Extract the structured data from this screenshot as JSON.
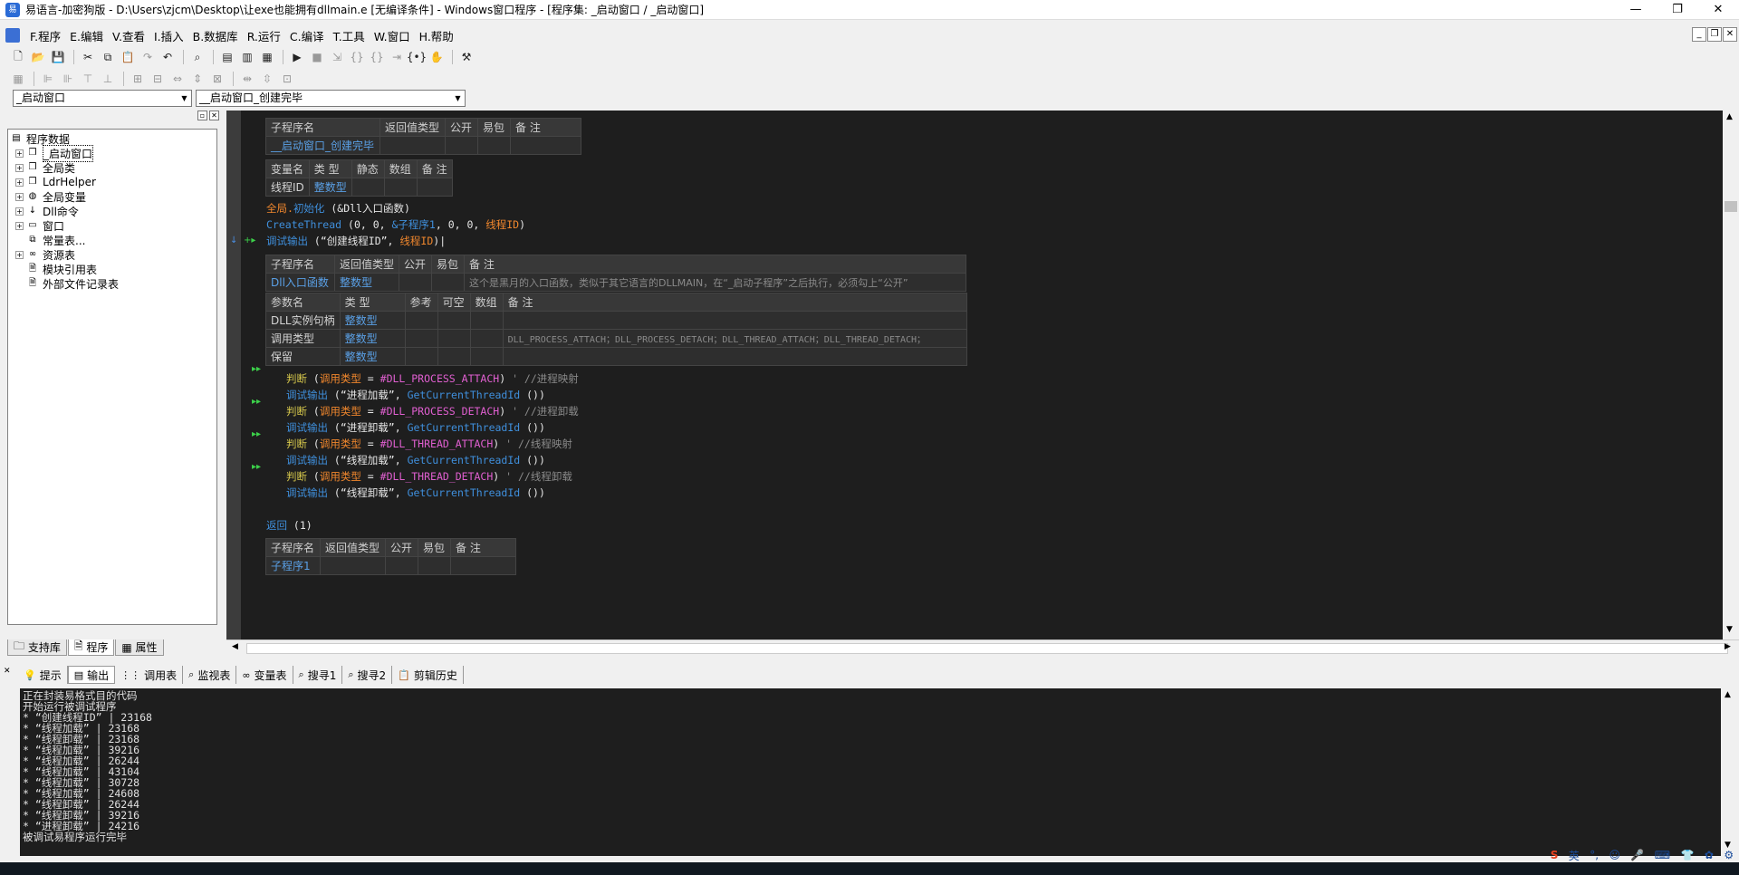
{
  "window": {
    "title": "易语言-加密狗版 - D:\\Users\\zjcm\\Desktop\\让exe也能拥有dllmain.e [无编译条件] - Windows窗口程序 - [程序集: _启动窗口 / _启动窗口]"
  },
  "menu": [
    "F.程序",
    "E.编辑",
    "V.查看",
    "I.插入",
    "B.数据库",
    "R.运行",
    "C.编译",
    "T.工具",
    "W.窗口",
    "H.帮助"
  ],
  "combos": {
    "left": "_启动窗口",
    "right": "__启动窗口_创建完毕"
  },
  "tree": {
    "root": "程序数据",
    "items": [
      "_启动窗口",
      "全局类",
      "LdrHelper",
      "全局变量",
      "Dll命令",
      "窗口",
      "常量表...",
      "资源表",
      "模块引用表",
      "外部文件记录表"
    ]
  },
  "panel_tabs": [
    "支持库",
    "程序",
    "属性"
  ],
  "code": {
    "t1": {
      "h": [
        "子程序名",
        "返回值类型",
        "公开",
        "易包",
        "备 注"
      ],
      "r": [
        "__启动窗口_创建完毕",
        "",
        "",
        "",
        ""
      ]
    },
    "t2": {
      "h": [
        "变量名",
        "类 型",
        "静态",
        "数组",
        "备 注"
      ],
      "r": [
        "线程ID",
        "整数型",
        "",
        "",
        ""
      ]
    },
    "line1": {
      "a": "全局.",
      "b": "初始化",
      "c": " (&Dll入口函数)"
    },
    "line2": {
      "a": "CreateThread",
      "b": " (0, 0, ",
      "c": "&子程序1",
      "d": ", 0, 0, ",
      "e": "线程ID",
      ")": ")"
    },
    "line3": {
      "a": "调试输出",
      "b": " (“创建线程ID”, ",
      "c": "线程ID",
      ")": ")"
    },
    "t3": {
      "h": [
        "子程序名",
        "返回值类型",
        "公开",
        "易包",
        "备 注"
      ],
      "r": [
        "Dll入口函数",
        "整数型",
        "",
        "",
        "这个是黑月的入口函数，类似于其它语言的DLLMAIN，在“_启动子程序”之后执行，必须勾上“公开”"
      ]
    },
    "t4": {
      "h": [
        "参数名",
        "类 型",
        "参考",
        "可空",
        "数组",
        "备 注"
      ],
      "rows": [
        [
          "DLL实例句柄",
          "整数型",
          "",
          "",
          "",
          ""
        ],
        [
          "调用类型",
          "整数型",
          "",
          "",
          "",
          "DLL_PROCESS_ATTACH；DLL_PROCESS_DETACH；DLL_THREAD_ATTACH；DLL_THREAD_DETACH；"
        ],
        [
          "保留",
          "整数型",
          "",
          "",
          "",
          ""
        ]
      ]
    },
    "ifs": [
      {
        "cond": "#DLL_PROCESS_ATTACH",
        "cmt": "' //进程映射",
        "body": "“进程加载”"
      },
      {
        "cond": "#DLL_PROCESS_DETACH",
        "cmt": "' //进程卸载",
        "body": "“进程卸载”"
      },
      {
        "cond": "#DLL_THREAD_ATTACH",
        "cmt": "' //线程映射",
        "body": "“线程加载”"
      },
      {
        "cond": "#DLL_THREAD_DETACH",
        "cmt": "' //线程卸载",
        "body": "“线程卸载”"
      }
    ],
    "kw_if": "判断",
    "kw_var": "调用类型",
    "eq": " = ",
    "kw_dbg": "调试输出",
    "fn": "GetCurrentThreadId",
    "fn_args": " ())",
    "ret": {
      "a": "返回",
      "b": " (1)"
    },
    "t5": {
      "h": [
        "子程序名",
        "返回值类型",
        "公开",
        "易包",
        "备 注"
      ],
      "r": [
        "子程序1",
        "",
        "",
        "",
        ""
      ]
    }
  },
  "output_tabs": [
    "提示",
    "输出",
    "调用表",
    "监视表",
    "变量表",
    "搜寻1",
    "搜寻2",
    "剪辑历史"
  ],
  "output_lines": [
    "正在封装易格式目的代码",
    "开始运行被调试程序",
    "* “创建线程ID” | 23168",
    "* “线程加载” | 23168",
    "* “线程卸载” | 23168",
    "* “线程加载” | 39216",
    "* “线程加载” | 26244",
    "* “线程加载” | 43104",
    "* “线程加载” | 30728",
    "* “线程加载” | 24608",
    "* “线程卸载” | 26244",
    "* “线程卸载” | 39216",
    "* “进程卸载” | 24216",
    "被调试易程序运行完毕"
  ],
  "tray": [
    "S",
    "英",
    "°,",
    "☺",
    "🎤",
    "⌨",
    "👕",
    "✿",
    "⚙"
  ]
}
